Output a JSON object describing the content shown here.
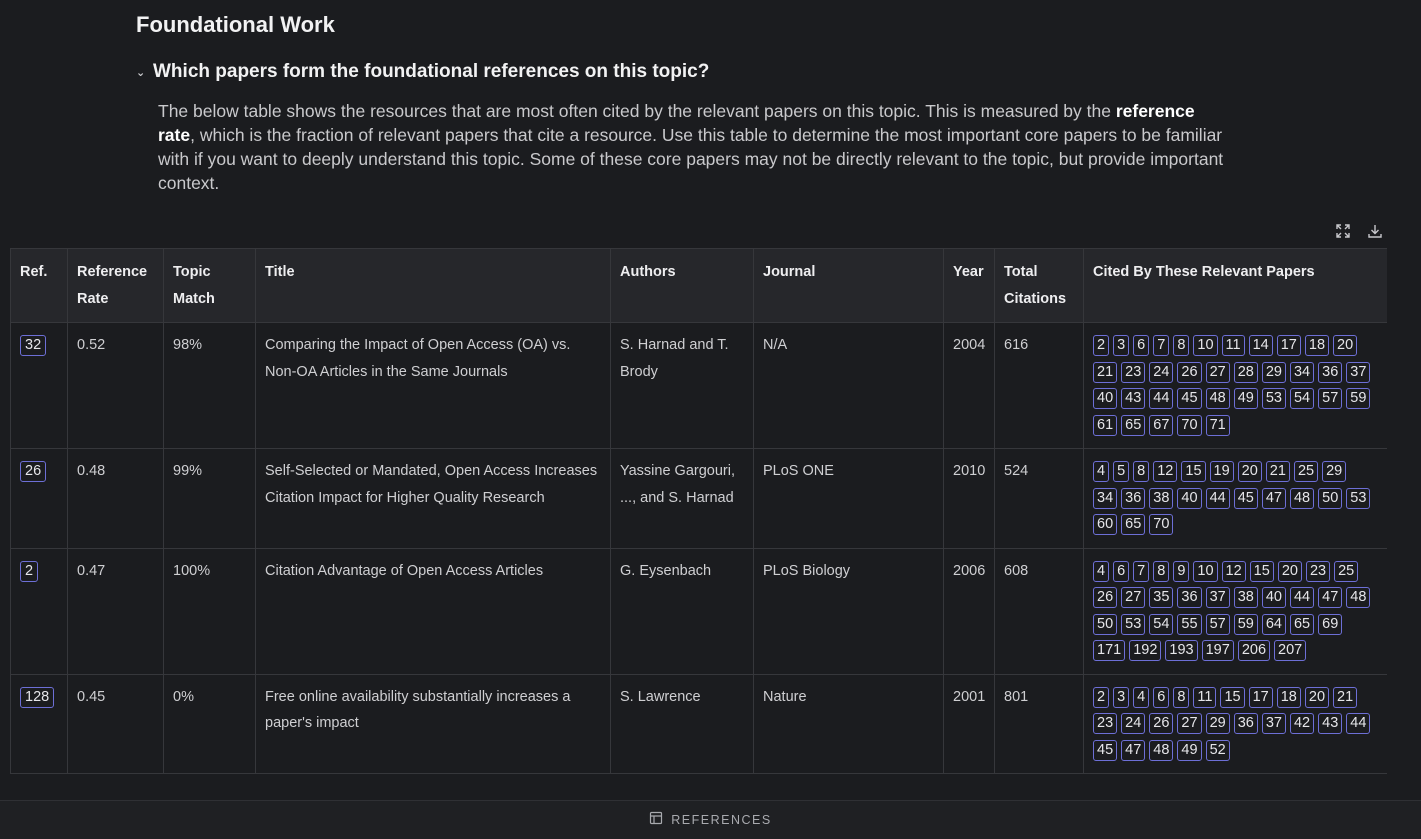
{
  "section": {
    "title": "Foundational Work",
    "question": "Which papers form the foundational references on this topic?",
    "desc_pre": "The below table shows the resources that are most often cited by the relevant papers on this topic. This is measured by the ",
    "desc_bold": "reference rate",
    "desc_post": ", which is the fraction of relevant papers that cite a resource. Use this table to determine the most important core papers to be familiar with if you want to deeply understand this topic. Some of these core papers may not be directly relevant to the topic, but provide important context."
  },
  "tools": {
    "expand_icon": "expand-icon",
    "download_icon": "download-icon"
  },
  "table": {
    "headers": [
      "Ref.",
      "Reference Rate",
      "Topic Match",
      "Title",
      "Authors",
      "Journal",
      "Year",
      "Total Citations",
      "Cited By These Relevant Papers"
    ],
    "rows": [
      {
        "ref": "32",
        "rate": "0.52",
        "match": "98%",
        "title": "Comparing the Impact of Open Access (OA) vs. Non-OA Articles in the Same Journals",
        "authors": "S. Harnad and T. Brody",
        "journal": "N/A",
        "year": "2004",
        "citations": "616",
        "cited_by": [
          "2",
          "3",
          "6",
          "7",
          "8",
          "10",
          "11",
          "14",
          "17",
          "18",
          "20",
          "21",
          "23",
          "24",
          "26",
          "27",
          "28",
          "29",
          "34",
          "36",
          "37",
          "40",
          "43",
          "44",
          "45",
          "48",
          "49",
          "53",
          "54",
          "57",
          "59",
          "61",
          "65",
          "67",
          "70",
          "71"
        ]
      },
      {
        "ref": "26",
        "rate": "0.48",
        "match": "99%",
        "title": "Self-Selected or Mandated, Open Access Increases Citation Impact for Higher Quality Research",
        "authors": "Yassine Gargouri, ..., and S. Harnad",
        "journal": "PLoS ONE",
        "year": "2010",
        "citations": "524",
        "cited_by": [
          "4",
          "5",
          "8",
          "12",
          "15",
          "19",
          "20",
          "21",
          "25",
          "29",
          "34",
          "36",
          "38",
          "40",
          "44",
          "45",
          "47",
          "48",
          "50",
          "53",
          "60",
          "65",
          "70"
        ]
      },
      {
        "ref": "2",
        "rate": "0.47",
        "match": "100%",
        "title": "Citation Advantage of Open Access Articles",
        "authors": "G. Eysenbach",
        "journal": "PLoS Biology",
        "year": "2006",
        "citations": "608",
        "cited_by": [
          "4",
          "6",
          "7",
          "8",
          "9",
          "10",
          "12",
          "15",
          "20",
          "23",
          "25",
          "26",
          "27",
          "35",
          "36",
          "37",
          "38",
          "40",
          "44",
          "47",
          "48",
          "50",
          "53",
          "54",
          "55",
          "57",
          "59",
          "64",
          "65",
          "69",
          "171",
          "192",
          "193",
          "197",
          "206",
          "207"
        ]
      },
      {
        "ref": "128",
        "rate": "0.45",
        "match": "0%",
        "title": "Free online availability substantially increases a paper's impact",
        "authors": "S. Lawrence",
        "journal": "Nature",
        "year": "2001",
        "citations": "801",
        "cited_by": [
          "2",
          "3",
          "4",
          "6",
          "8",
          "11",
          "15",
          "17",
          "18",
          "20",
          "21",
          "23",
          "24",
          "26",
          "27",
          "29",
          "36",
          "37",
          "42",
          "43",
          "44",
          "45",
          "47",
          "48",
          "49",
          "52"
        ]
      }
    ]
  },
  "footer": {
    "label": "REFERENCES",
    "icon": "table-icon"
  }
}
